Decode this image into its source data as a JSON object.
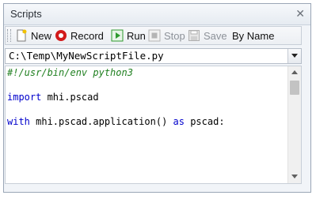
{
  "panel": {
    "title": "Scripts"
  },
  "toolbar": {
    "new_label": "New",
    "record_label": "Record",
    "run_label": "Run",
    "stop_label": "Stop",
    "save_label": "Save",
    "sort_label": "By Name"
  },
  "script_path": "C:\\Temp\\MyNewScriptFile.py",
  "editor": {
    "lines": [
      {
        "text": "#!/usr/bin/env python3"
      },
      {
        "text": ""
      },
      {
        "kw": "import",
        "rest": " mhi.pscad"
      },
      {
        "text": ""
      },
      {
        "kw": "with",
        "mid": " mhi.pscad.application() ",
        "kw2": "as",
        "rest": " pscad:"
      }
    ]
  },
  "icons": {
    "close": "close-icon",
    "new": "new-document-icon",
    "record": "record-icon",
    "run": "run-icon",
    "stop": "stop-icon",
    "save": "save-icon",
    "dropdown": "chevron-down-icon"
  },
  "colors": {
    "comment": "#1f7f1f",
    "keyword": "#0000cc",
    "record": "#d21a1a",
    "run": "#2e9a2e"
  }
}
